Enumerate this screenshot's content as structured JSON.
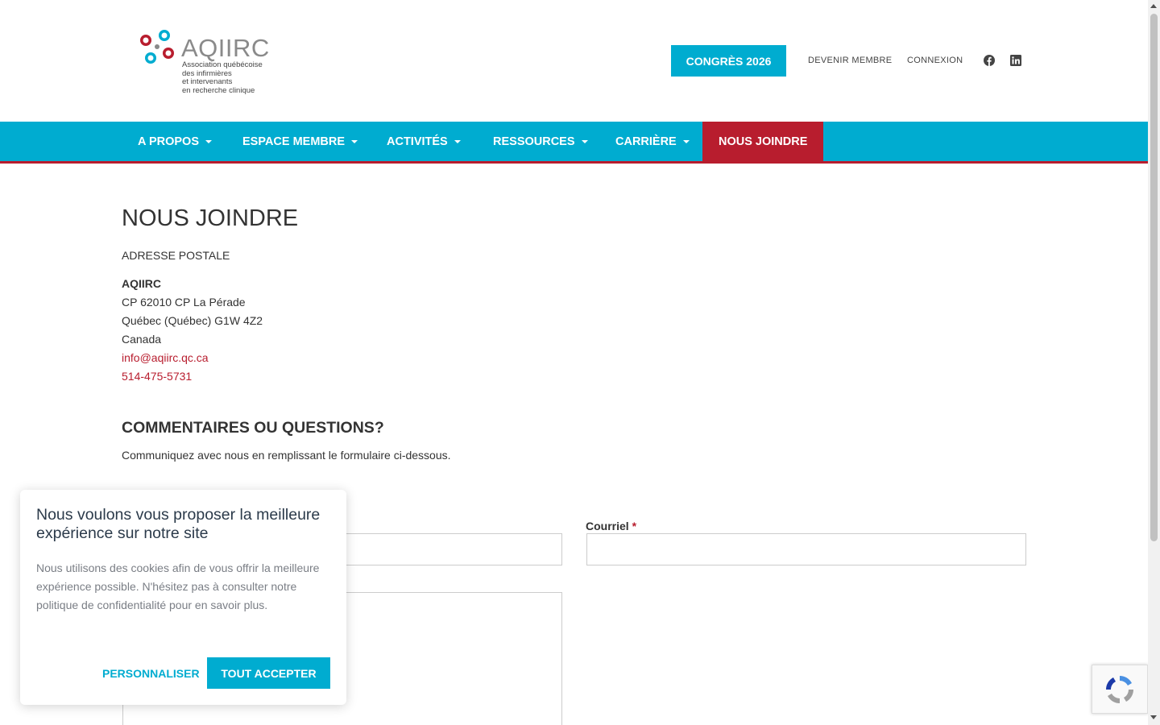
{
  "header": {
    "logo_word": "AQIIRC",
    "logo_sub": [
      "Association québécoise",
      "des infirmières",
      "et intervenants",
      "en recherche clinique"
    ],
    "congres_label": "CONGRÈS 2026",
    "devenir_label": "DEVENIR MEMBRE",
    "connexion_label": "CONNEXION"
  },
  "nav": {
    "items": [
      {
        "label": "A PROPOS"
      },
      {
        "label": "ESPACE MEMBRE"
      },
      {
        "label": "ACTIVITÉS"
      },
      {
        "label": "RESSOURCES"
      },
      {
        "label": "CARRIÈRE"
      },
      {
        "label": "NOUS JOINDRE"
      }
    ]
  },
  "main": {
    "title": "NOUS JOINDRE",
    "address_label": "ADRESSE POSTALE",
    "org": "AQIIRC",
    "line1": "CP 62010 CP La Pérade",
    "line2": "Québec (Québec)  G1W 4Z2",
    "line3": "Canada",
    "email": "info@aqiirc.qc.ca",
    "phone": "514-475-5731",
    "section_title": "COMMENTAIRES OU QUESTIONS?",
    "section_sub": "Communiquez avec nous en remplissant le formulaire ci-dessous.",
    "courriel_label": "Courriel",
    "required_mark": "*"
  },
  "cookie": {
    "title": "Nous voulons vous proposer la meilleure expérience sur notre site",
    "text": "Nous utilisons des cookies afin de vous offrir la meilleure expérience possible. N'hésitez pas à consulter notre politique de confidentialité pour en savoir plus.",
    "customize_label": "PERSONNALISER",
    "accept_label": "TOUT ACCEPTER"
  },
  "colors": {
    "accent": "#00acd0",
    "brand_red": "#b81d2e"
  }
}
